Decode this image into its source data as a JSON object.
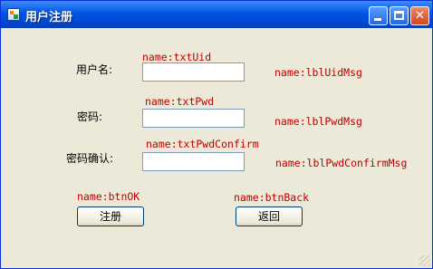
{
  "window": {
    "title": "用户注册",
    "controls": {
      "minimize": "minimize",
      "maximize": "maximize",
      "close": "✕"
    }
  },
  "form": {
    "uid": {
      "label": "用户名:",
      "control_name": "name:txtUid",
      "value": "",
      "msg_name": "name:lblUidMsg"
    },
    "pwd": {
      "label": "密码:",
      "control_name": "name:txtPwd",
      "value": "",
      "msg_name": "name:lblPwdMsg"
    },
    "pwd_confirm": {
      "label": "密码确认:",
      "control_name": "name:txtPwdConfirm",
      "value": "",
      "msg_name": "name:lblPwdConfirmMsg"
    }
  },
  "buttons": {
    "ok": {
      "control_name": "name:btnOK",
      "label": "注册"
    },
    "back": {
      "control_name": "name:btnBack",
      "label": "返回"
    }
  },
  "colors": {
    "annotation": "#c00000",
    "titlebar": "#0054e3",
    "window_bg": "#ece9d8"
  }
}
